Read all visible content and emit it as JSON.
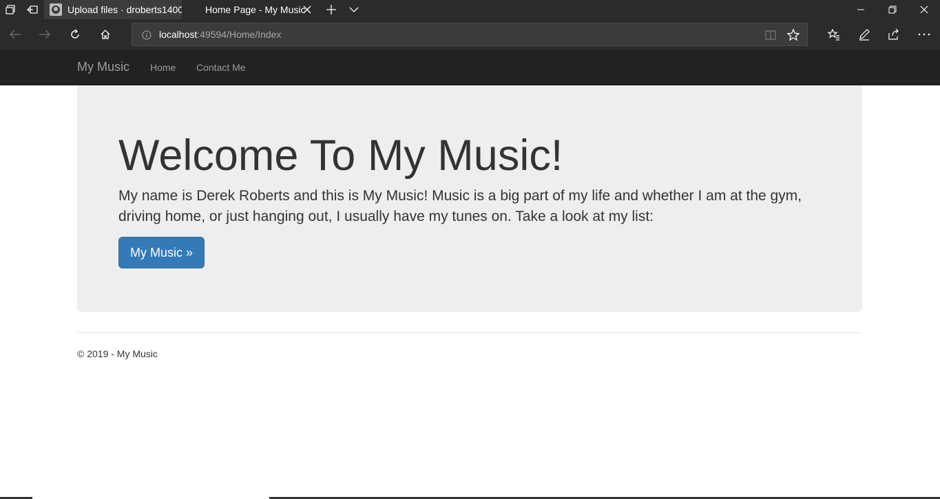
{
  "browser": {
    "tabs": [
      {
        "title": "Upload files · droberts1400",
        "active": false
      },
      {
        "title": "Home Page - My Music",
        "active": true
      }
    ],
    "address": {
      "host": "localhost",
      "path": ":49594/Home/Index"
    }
  },
  "site": {
    "brand": "My Music",
    "nav": [
      {
        "label": "Home"
      },
      {
        "label": "Contact Me"
      }
    ],
    "jumbotron": {
      "heading": "Welcome To My Music!",
      "text": "My name is Derek Roberts and this is My Music! Music is a big part of my life and whether I am at the gym, driving home, or just hanging out, I usually have my tunes on. Take a look at my list:",
      "button_label": "My Music »"
    },
    "footer": "© 2019 - My Music"
  },
  "colors": {
    "chrome": "#2b2b2b",
    "navbar": "#222222",
    "jumbotron": "#eeeeee",
    "primary": "#337ab7"
  }
}
